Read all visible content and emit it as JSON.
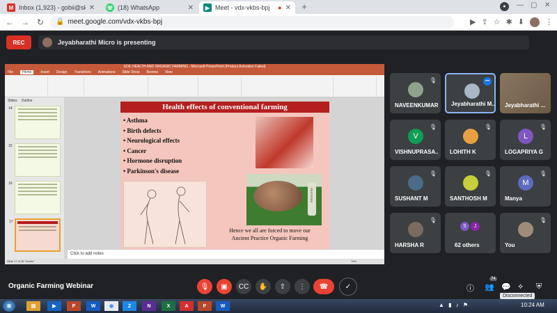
{
  "browser": {
    "tabs": [
      {
        "label": "Inbox (1,923) - gobii@skacas.ac",
        "icon": "gmail-icon",
        "color": "#d93025",
        "active": false
      },
      {
        "label": "(18) WhatsApp",
        "icon": "whatsapp-icon",
        "color": "#25d366",
        "active": false
      },
      {
        "label": "Meet - vdx-vkbs-bpj",
        "icon": "meet-icon",
        "color": "#00897b",
        "active": true
      }
    ],
    "url": "meet.google.com/vdx-vkbs-bpj"
  },
  "meet": {
    "rec_label": "REC",
    "presenting_text": "Jeyabharathi Micro is presenting",
    "meeting_name": "Organic Farming Webinar",
    "participants_count": "74",
    "disconnected_tooltip": "Disconnected",
    "tiles": [
      {
        "name": "NAVEENKUMAR...",
        "type": "image",
        "color": "#8fa38c"
      },
      {
        "name": "Jeyabharathi M...",
        "type": "image",
        "color": "#a8b6c5"
      },
      {
        "name": "Jeyabharathi ...",
        "type": "video",
        "color": "#6b5a44"
      },
      {
        "name": "VISHNUPRASA...",
        "type": "letter",
        "letter": "V",
        "color": "#0f9d58"
      },
      {
        "name": "LOHITH K",
        "type": "image",
        "color": "#e8a042"
      },
      {
        "name": "LOGAPRIYA G",
        "type": "letter",
        "letter": "L",
        "color": "#7e57c2"
      },
      {
        "name": "SUSHANT M",
        "type": "image",
        "color": "#4a6b8a"
      },
      {
        "name": "SANTHOSH M",
        "type": "image",
        "color": "#c6ce3a"
      },
      {
        "name": "Manya",
        "type": "letter",
        "letter": "M",
        "color": "#5c6bc0"
      },
      {
        "name": "HARSHA R",
        "type": "image",
        "color": "#7a6b5e"
      },
      {
        "name": "62 others",
        "type": "others",
        "letters": [
          "S",
          "J"
        ]
      },
      {
        "name": "You",
        "type": "image",
        "color": "#9e8c7a"
      }
    ]
  },
  "ppt": {
    "title_bar": "SOIL HEALTH AND ORGANIC FARMING - Microsoft PowerPoint (Product Activation Failed)",
    "ribbon_tabs": [
      "File",
      "Home",
      "Insert",
      "Design",
      "Transitions",
      "Animations",
      "Slide Show",
      "Review",
      "View"
    ],
    "panel_tabs": [
      "Slides",
      "Outline"
    ],
    "slide_numbers": [
      "14",
      "15",
      "16",
      "17"
    ],
    "slide": {
      "title": "Health effects of conventional farming",
      "bullets": [
        "Asthma",
        "Birth defects",
        "Neurological effects",
        "Cancer",
        "Hormone disruption",
        "Parkinson's disease"
      ],
      "footer_line1": "Hence we all are forced to move our",
      "footer_line2": "Ancient Practice Organic Farming",
      "bottle_label": "PESTICIDE"
    },
    "notes_placeholder": "Click to add notes",
    "status": "Slide 17 of 38   \"Austin\"",
    "zoom": "76%"
  },
  "taskbar": {
    "time": "10:24 AM"
  }
}
